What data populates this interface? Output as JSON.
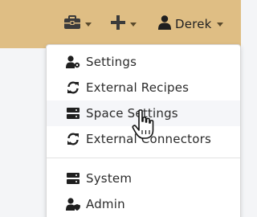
{
  "topbar": {
    "background_color": "#dfbe84",
    "tools_icon": "toolbox-icon",
    "add_icon": "plus-icon",
    "user_icon": "user-icon",
    "user_name": "Derek"
  },
  "menu": {
    "items": [
      {
        "label": "Settings",
        "icon": "user-gear-icon"
      },
      {
        "label": "External Recipes",
        "icon": "sync-icon"
      },
      {
        "label": "Space Settings",
        "icon": "server-icon",
        "hovered": true
      },
      {
        "label": "External Connectors",
        "icon": "sync-icon"
      },
      {
        "label": "System",
        "icon": "server-icon"
      },
      {
        "label": "Admin",
        "icon": "user-shield-icon"
      }
    ]
  }
}
